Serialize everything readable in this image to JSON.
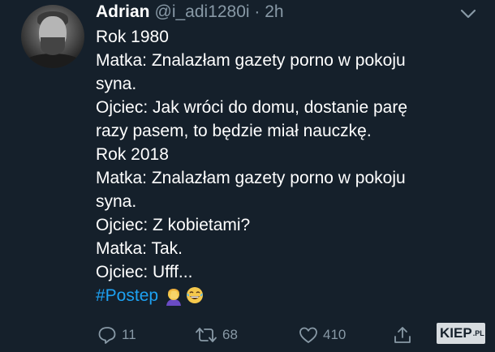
{
  "author": {
    "name": "Adrian",
    "handle": "@i_adi1280i · 2h"
  },
  "tweet": {
    "lines": [
      "Rok 1980",
      "Matka: Znalazłam gazety porno w pokoju",
      "syna.",
      "Ojciec: Jak wróci do domu, dostanie parę",
      "razy pasem, to będzie miał nauczkę.",
      "Rok 2018",
      "Matka: Znalazłam gazety porno w pokoju",
      "syna.",
      "Ojciec: Z kobietami?",
      "Matka: Tak.",
      "Ojciec: Ufff..."
    ],
    "hashtag": "#Postep"
  },
  "actions": {
    "replies": "11",
    "retweets": "68",
    "likes": "410"
  },
  "watermark": {
    "text": "KIEP",
    "suffix": ".PL"
  },
  "colors": {
    "background": "#15202b",
    "text": "#ffffff",
    "muted": "#8899a6",
    "link": "#1da1f2"
  },
  "icons": [
    "chevron-down-icon",
    "facepalm-emoji",
    "laughing-crying-emoji",
    "reply-icon",
    "retweet-icon",
    "like-icon",
    "share-icon"
  ]
}
